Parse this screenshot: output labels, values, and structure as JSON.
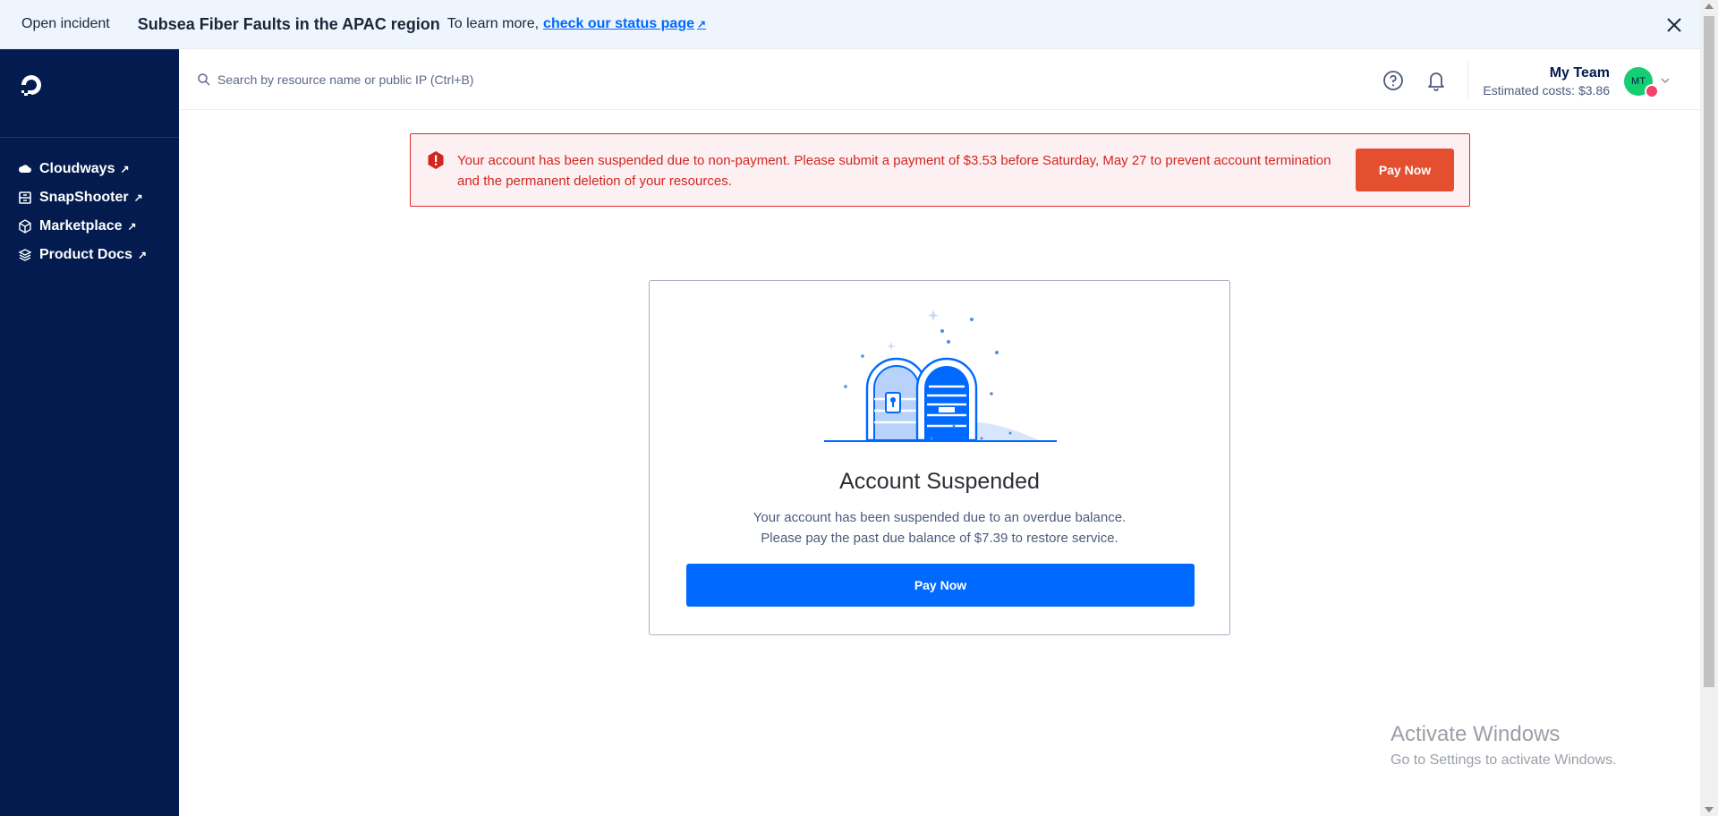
{
  "incident": {
    "tag": "Open incident",
    "title": "Subsea Fiber Faults in the APAC region",
    "text": "To learn more,",
    "link": "check our status page",
    "link_icon": "↗"
  },
  "sidebar": {
    "items": [
      {
        "label": "Cloudways",
        "icon": "cloud-icon"
      },
      {
        "label": "SnapShooter",
        "icon": "snapshot-icon"
      },
      {
        "label": "Marketplace",
        "icon": "cube-icon"
      },
      {
        "label": "Product Docs",
        "icon": "layers-icon"
      }
    ],
    "external_icon": "↗"
  },
  "header": {
    "search_placeholder": "Search by resource name or public IP (Ctrl+B)",
    "team_name": "My Team",
    "estimated_costs": "Estimated costs: $3.86",
    "avatar_initials": "MT"
  },
  "alert": {
    "message": "Your account has been suspended due to non-payment. Please submit a payment of $3.53 before Saturday, May 27 to prevent account termination and the permanent deletion of your resources.",
    "button": "Pay Now"
  },
  "card": {
    "title": "Account Suspended",
    "line1": "Your account has been suspended due to an overdue balance.",
    "line2": "Please pay the past due balance of $7.39 to restore service.",
    "button": "Pay Now"
  },
  "watermark": {
    "title": "Activate Windows",
    "subtitle": "Go to Settings to activate Windows."
  },
  "colors": {
    "sidebar_bg": "#031b4e",
    "brand_blue": "#0069ff",
    "alert_red": "#d0261f",
    "alert_button": "#e4502f",
    "avatar_green": "#15cd72"
  }
}
